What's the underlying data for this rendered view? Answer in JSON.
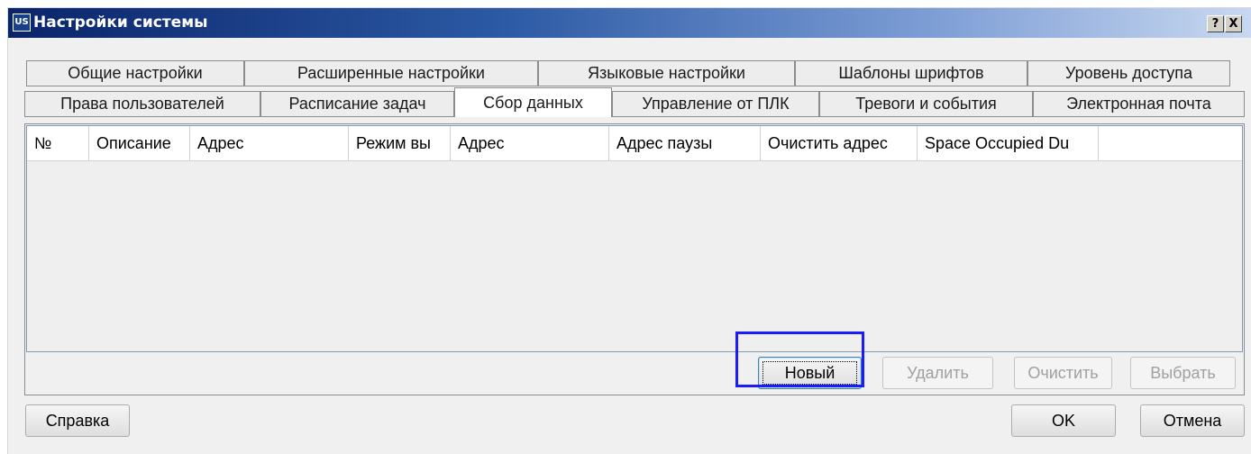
{
  "window": {
    "title": "Настройки системы",
    "icon_text": "US",
    "help_label": "?",
    "close_label": "X"
  },
  "tabs_row1": [
    {
      "label": "Общие настройки"
    },
    {
      "label": "Расширенные настройки"
    },
    {
      "label": "Языковые настройки"
    },
    {
      "label": "Шаблоны шрифтов"
    },
    {
      "label": "Уровень доступа"
    }
  ],
  "tabs_row2": [
    {
      "label": "Права пользователей"
    },
    {
      "label": "Расписание задач"
    },
    {
      "label": "Сбор данных",
      "active": true
    },
    {
      "label": "Управление от ПЛК"
    },
    {
      "label": "Тревоги и события"
    },
    {
      "label": "Электронная почта"
    }
  ],
  "grid": {
    "columns": [
      "№",
      "Описание",
      "Адрес",
      "Режим вы",
      "Адрес",
      "Адрес паузы",
      "Очистить адрес",
      "Space Occupied Du",
      ""
    ]
  },
  "panel_buttons": {
    "new": "Новый",
    "delete": "Удалить",
    "clear": "Очистить",
    "select": "Выбрать"
  },
  "footer": {
    "help": "Справка",
    "ok": "OK",
    "cancel": "Отмена"
  },
  "colors": {
    "highlight": "#1a1aff",
    "title_gradient_start": "#0a246a"
  }
}
